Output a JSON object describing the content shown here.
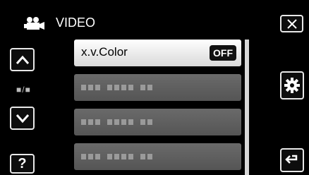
{
  "header": {
    "title": "VIDEO",
    "icon": "video-camera-icon"
  },
  "nav": {
    "page_indicator": "■/■",
    "help_label": "?"
  },
  "menu": {
    "items": [
      {
        "label": "x.v.Color",
        "value": "OFF",
        "state": "active"
      },
      {
        "label": "",
        "state": "dimmed"
      },
      {
        "label": "",
        "state": "dimmed"
      },
      {
        "label": "",
        "state": "dimmed"
      }
    ]
  },
  "icons": {
    "close": "close-icon",
    "up": "chevron-up-icon",
    "down": "chevron-down-icon",
    "settings": "gear-icon",
    "back": "back-icon"
  }
}
